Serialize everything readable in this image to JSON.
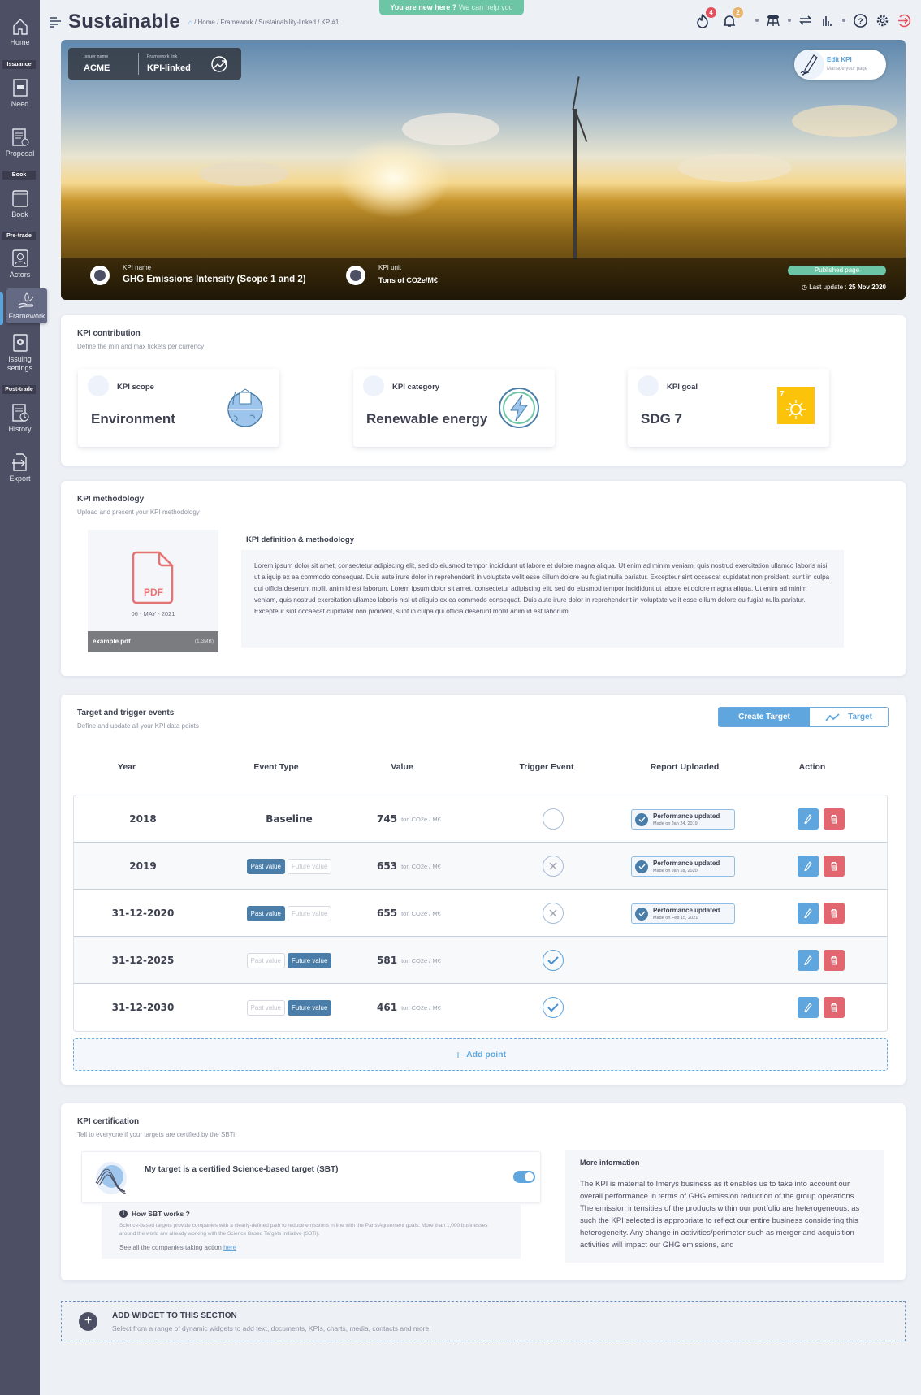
{
  "app": {
    "title": "Sustainable"
  },
  "breadcrumb": "/ Home / Framework / Sustainability-linked / KPI#1",
  "help_banner": {
    "bold": "You are new here ?",
    "text": "We can help you"
  },
  "top_icons": {
    "fire_badge": "4",
    "bell_badge": "2"
  },
  "sidebar": {
    "items": [
      {
        "label": "Home",
        "icon": "home-icon"
      },
      {
        "label": "Need",
        "icon": "need-icon"
      },
      {
        "label": "Proposal",
        "icon": "proposal-icon"
      },
      {
        "label": "Book",
        "icon": "book-icon"
      },
      {
        "label": "Actors",
        "icon": "actors-icon"
      },
      {
        "label": "Framework",
        "icon": "framework-icon",
        "active": true
      },
      {
        "label": "Issuing settings",
        "icon": "settings-doc-icon"
      },
      {
        "label": "History",
        "icon": "history-icon"
      },
      {
        "label": "Export",
        "icon": "export-icon"
      }
    ],
    "sections": [
      "Issuance",
      "Book",
      "Pre-trade",
      "Post-trade"
    ]
  },
  "hero": {
    "issuer_label": "Issuer name",
    "issuer_value": "ACME",
    "framework_label": "Framework link",
    "framework_value": "KPI-linked",
    "edit_title": "Edit KPI",
    "edit_sub": "Manage your page",
    "kpi_name_label": "KPI name",
    "kpi_name": "GHG Emissions Intensity (Scope 1 and 2)",
    "kpi_unit_label": "KPI unit",
    "kpi_unit": "Tons of CO2e/M€",
    "status": "Published page",
    "last_update_label": "Last update :",
    "last_update": "25 Nov 2020"
  },
  "contribution": {
    "title": "KPI contribution",
    "subtitle": "Define the min and max tickets per currency",
    "cards": [
      {
        "label": "KPI scope",
        "value": "Environment"
      },
      {
        "label": "KPI category",
        "value": "Renewable energy"
      },
      {
        "label": "KPI goal",
        "value": "SDG 7"
      }
    ]
  },
  "methodology": {
    "title": "KPI methodology",
    "subtitle": "Upload and present your KPI methodology",
    "file_date": "06 - MAY - 2021",
    "file_name": "example.pdf",
    "file_size": "(1.3MB)",
    "pdf_label": "PDF",
    "definition_title": "KPI definition & methodology",
    "definition_text": "Lorem ipsum dolor sit amet, consectetur adipiscing elit, sed do eiusmod tempor incididunt ut labore et dolore magna aliqua. Ut enim ad minim veniam, quis nostrud exercitation ullamco laboris nisi ut aliquip ex ea commodo consequat. Duis aute irure dolor in reprehenderit in voluptate velit esse cillum dolore eu fugiat nulla pariatur. Excepteur sint occaecat cupidatat non proident, sunt in culpa qui officia deserunt mollit anim id est laborum. Lorem ipsum dolor sit amet, consectetur adipiscing elit, sed do eiusmod tempor incididunt ut labore et dolore magna aliqua. Ut enim ad minim veniam, quis nostrud exercitation ullamco laboris nisi ut aliquip ex ea commodo consequat. Duis aute irure dolor in reprehenderit in voluptate velit esse cillum dolore eu fugiat nulla pariatur. Excepteur sint occaecat cupidatat non proident, sunt in culpa qui officia deserunt mollit anim id est laborum."
  },
  "targets": {
    "title": "Target and trigger events",
    "subtitle": "Define and update all your KPI data points",
    "create_button": "Create Target",
    "target_button": "Target",
    "columns": [
      "Year",
      "Event Type",
      "Value",
      "Trigger Event",
      "Report Uploaded",
      "Action"
    ],
    "past_label": "Past value",
    "future_label": "Future value",
    "unit": "ton CO2e / M€",
    "report_title": "Performance updated",
    "rows": [
      {
        "year": "2018",
        "event": "Baseline",
        "value": "745",
        "trigger": "empty",
        "report_date": "Made on Jan 24, 2019"
      },
      {
        "year": "2019",
        "event": "past",
        "value": "653",
        "trigger": "cross",
        "report_date": "Made on Jan 18, 2020"
      },
      {
        "year": "31-12-2020",
        "event": "past",
        "value": "655",
        "trigger": "cross",
        "report_date": "Made on Feb 15, 2021"
      },
      {
        "year": "31-12-2025",
        "event": "future",
        "value": "581",
        "trigger": "check",
        "report_date": ""
      },
      {
        "year": "31-12-2030",
        "event": "future",
        "value": "461",
        "trigger": "check",
        "report_date": ""
      }
    ],
    "add_point": "Add point"
  },
  "certification": {
    "title": "KPI certification",
    "subtitle": "Tell to everyone if your targets are certified by the SBTi",
    "sbt_label": "My target is a certified Science-based target (SBT)",
    "sbt_enabled": true,
    "how_title": "How SBT works ?",
    "how_text": "Science-based targets provide companies with a clearly-defined path to reduce emissions in line with the Paris Agreement goals. More than 1,000 businesses around the world are already working with the Science Based Targets initiative (SBTi).",
    "see_all": "See all the companies taking action",
    "here_link": "here",
    "more_title": "More information",
    "more_text": " The KPI is material to Imerys business as it enables us to take into account our overall performance in terms of GHG emission reduction of the group operations. The emission intensities of the products within our portfolio are heterogeneous, as such the KPI selected is appropriate to reflect our entire business considering this heterogeneity. Any change in activities/perimeter such as merger and acquisition activities will impact our GHG emissions, and"
  },
  "add_widget": {
    "title": "ADD WIDGET TO THIS SECTION",
    "subtitle": "Select from a range of dynamic widgets to add text, documents, KPIs, charts, media, contacts and more."
  },
  "colors": {
    "accent": "#5fa5de",
    "success": "#6cc6a6",
    "danger": "#e26670",
    "sidebar": "#4d5064"
  }
}
